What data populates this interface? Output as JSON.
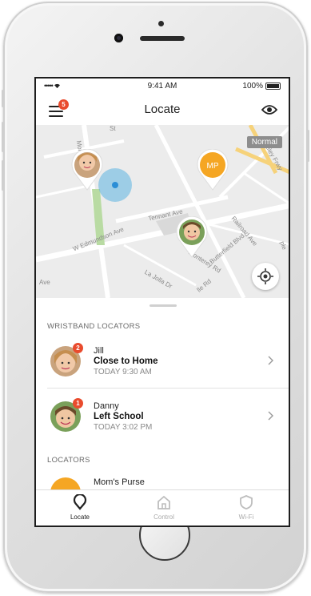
{
  "status_bar": {
    "signal": "••••• ",
    "time": "9:41 AM",
    "battery": "100%"
  },
  "nav": {
    "title": "Locate",
    "menu_badge": "5"
  },
  "map": {
    "mode_label": "Normal",
    "pin_initials": "MP",
    "streets": [
      "W Edmundson Ave",
      "Tennant Ave",
      "Monterey Rd",
      "Butterfield Blvd",
      "Railroad Ave",
      "Valley Frwy",
      "La Jolla Dr",
      "Ave",
      "Monte",
      "St",
      "lle Rd",
      "ple"
    ]
  },
  "sections": {
    "wristband": "WRISTBAND LOCATORS",
    "locators": "LOCATORS"
  },
  "wristband_locators": [
    {
      "name": "Jill",
      "status": "Close to Home",
      "time": "TODAY 9:30 AM",
      "badge": "2"
    },
    {
      "name": "Danny",
      "status": "Left School",
      "time": "TODAY 3:02 PM",
      "badge": "1"
    }
  ],
  "locators": [
    {
      "name": "Mom's Purse"
    }
  ],
  "tabs": [
    {
      "label": "Locate",
      "icon": "locate-pin-icon",
      "active": true
    },
    {
      "label": "Control",
      "icon": "home-icon",
      "active": false
    },
    {
      "label": "Wi-Fi",
      "icon": "shield-icon",
      "active": false
    }
  ],
  "colors": {
    "accent": "#f5a623",
    "badge": "#e94b2d",
    "accuracy": "#5cb4e2",
    "text": "#222222"
  }
}
